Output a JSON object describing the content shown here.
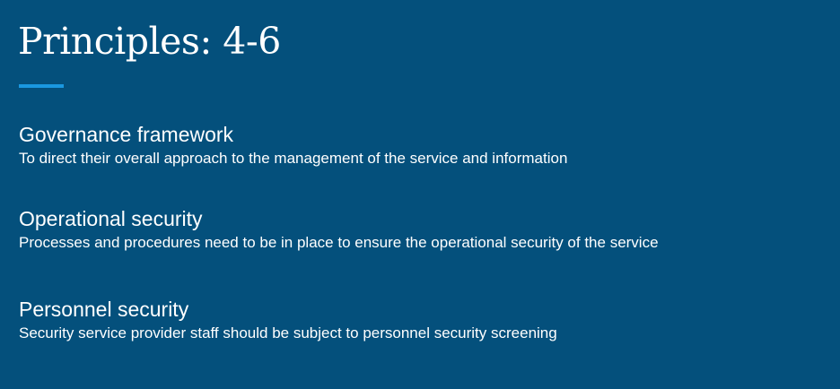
{
  "slide": {
    "title": "Principles: 4-6",
    "accent_color": "#1a98e0",
    "background_color": "#04507c",
    "principles": [
      {
        "heading": "Governance framework",
        "description": "To direct their overall approach to the management of the service and information"
      },
      {
        "heading": "Operational security",
        "description": "Processes and procedures need to be in place to ensure the operational security of the service"
      },
      {
        "heading": "Personnel security",
        "description": "Security service provider staff should be subject to personnel security screening"
      }
    ]
  }
}
